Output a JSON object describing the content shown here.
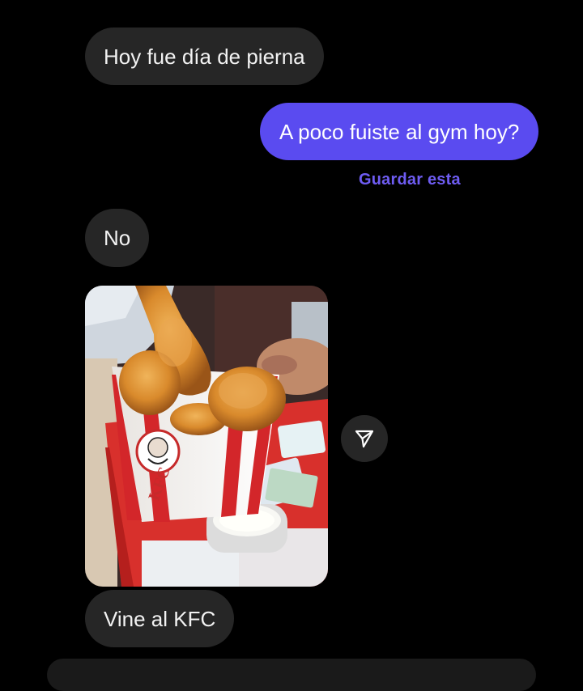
{
  "conversation": {
    "messages": [
      {
        "text": "Hoy fue día de pierna",
        "direction": "received"
      },
      {
        "text": "A poco fuiste al gym hoy?",
        "direction": "sent"
      },
      {
        "text": "No",
        "direction": "received"
      },
      {
        "text": "Vine al KFC",
        "direction": "received"
      }
    ],
    "save_action": "Guardar esta",
    "photo": {
      "bucket_text": "KFC",
      "content": "KFC fried chicken bucket on red tray"
    },
    "share_icon": "paper-plane-icon"
  },
  "colors": {
    "background": "#000000",
    "received_bubble": "#262626",
    "sent_bubble": "#5a4bf0",
    "link": "#6e5cf2",
    "text": "#f2f2f2"
  }
}
